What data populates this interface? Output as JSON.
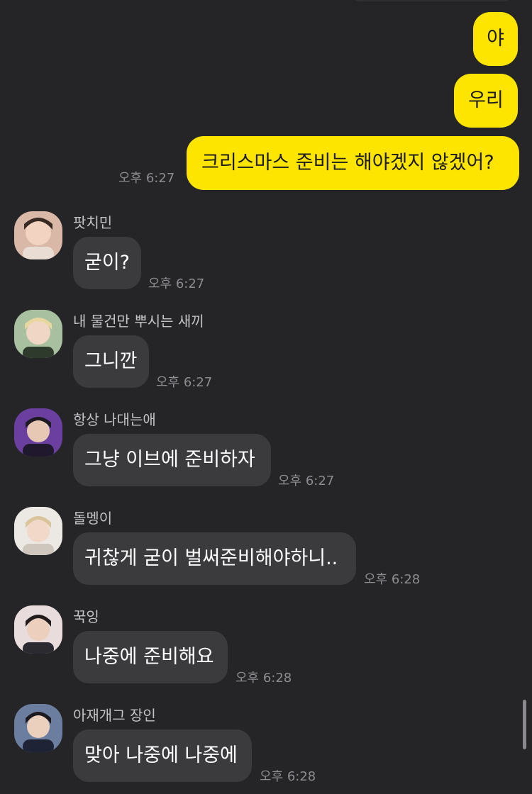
{
  "colors": {
    "background": "#252528",
    "outgoing_bubble": "#FEE500",
    "incoming_bubble": "#3b3b3e",
    "timestamp": "#8c8c91"
  },
  "outgoing": [
    {
      "text": "야"
    },
    {
      "text": "우리"
    },
    {
      "text": "크리스마스 준비는 해야겠지 않겠어?",
      "time": "오후 6:27"
    }
  ],
  "incoming": [
    {
      "sender": "팟치민",
      "text": "굳이?",
      "time": "오후 6:27",
      "avatar_icon": "profile-photo-icon"
    },
    {
      "sender": "내 물건만 뿌시는 새끼",
      "text": "그니깐",
      "time": "오후 6:27",
      "avatar_icon": "profile-photo-icon"
    },
    {
      "sender": "항상 나대는애",
      "text": "그냥 이브에 준비하자",
      "time": "오후 6:27",
      "avatar_icon": "profile-photo-icon"
    },
    {
      "sender": "돌멩이",
      "text": "귀찮게 굳이 벌써준비해야하니..",
      "time": "오후 6:28",
      "avatar_icon": "profile-photo-icon"
    },
    {
      "sender": "꾹잉",
      "text": "나중에 준비해요",
      "time": "오후 6:28",
      "avatar_icon": "profile-photo-icon"
    },
    {
      "sender": "아재개그 장인",
      "text": "맞아 나중에 나중에",
      "time": "오후 6:28",
      "avatar_icon": "profile-photo-icon"
    }
  ]
}
